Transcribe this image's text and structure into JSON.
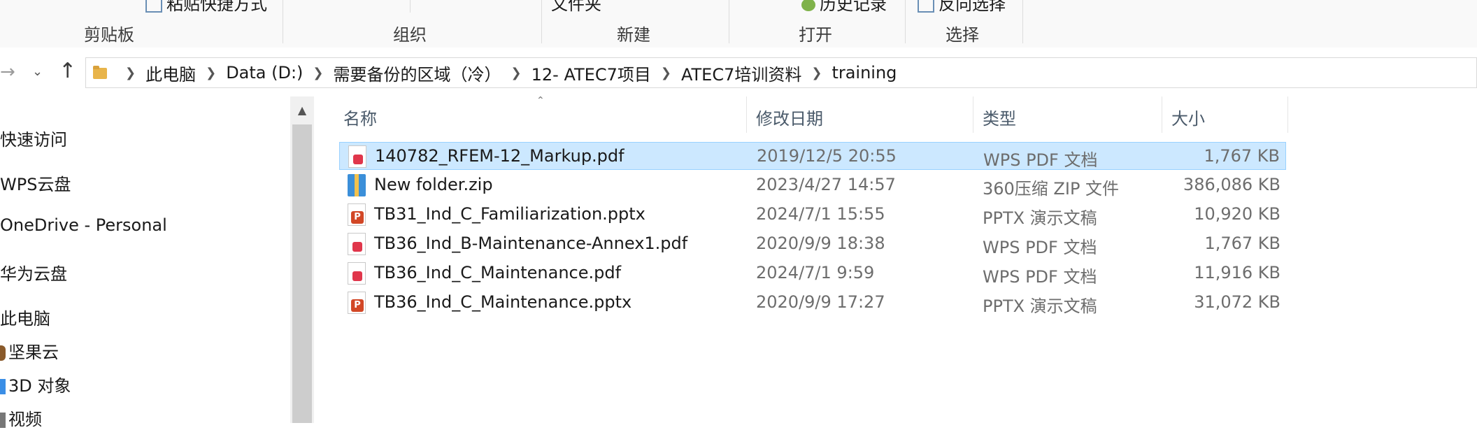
{
  "ribbon": {
    "groups": [
      {
        "label": "剪贴板"
      },
      {
        "label": "组织"
      },
      {
        "label": "新建"
      },
      {
        "label": "打开"
      },
      {
        "label": "选择"
      }
    ],
    "cut_text_1": "粘贴快捷方式",
    "cut_text_2": "文件夹",
    "cut_text_3": "历史记录",
    "cut_text_4": "反向选择"
  },
  "nav": {
    "back_icon": "back-arrow-icon",
    "forward_icon": "forward-arrow-icon",
    "recent_icon": "chevron-down-icon",
    "up_icon": "up-arrow-icon"
  },
  "breadcrumb": [
    "此电脑",
    "Data (D:)",
    "需要备份的区域（冷）",
    "12- ATEC7项目",
    "ATEC7培训资料",
    "training"
  ],
  "sidebar": {
    "items": [
      {
        "label": "快速访问"
      },
      {
        "label": "WPS云盘"
      },
      {
        "label": "OneDrive - Personal"
      },
      {
        "label": "华为云盘"
      },
      {
        "label": "此电脑"
      },
      {
        "label": "坚果云"
      },
      {
        "label": "3D 对象"
      },
      {
        "label": "视频"
      }
    ]
  },
  "columns": {
    "name": "名称",
    "date": "修改日期",
    "type": "类型",
    "size": "大小"
  },
  "files": [
    {
      "name": "140782_RFEM-12_Markup.pdf",
      "date": "2019/12/5 20:55",
      "type": "WPS PDF 文档",
      "size": "1,767 KB",
      "icon": "pdf-icon",
      "selected": true
    },
    {
      "name": "New folder.zip",
      "date": "2023/4/27 14:57",
      "type": "360压缩 ZIP 文件",
      "size": "386,086 KB",
      "icon": "zip-icon",
      "selected": false
    },
    {
      "name": "TB31_Ind_C_Familiarization.pptx",
      "date": "2024/7/1 15:55",
      "type": "PPTX 演示文稿",
      "size": "10,920 KB",
      "icon": "pptx-icon",
      "selected": false
    },
    {
      "name": "TB36_Ind_B-Maintenance-Annex1.pdf",
      "date": "2020/9/9 18:38",
      "type": "WPS PDF 文档",
      "size": "1,767 KB",
      "icon": "pdf-icon",
      "selected": false
    },
    {
      "name": "TB36_Ind_C_Maintenance.pdf",
      "date": "2024/7/1 9:59",
      "type": "WPS PDF 文档",
      "size": "11,916 KB",
      "icon": "pdf-icon",
      "selected": false
    },
    {
      "name": "TB36_Ind_C_Maintenance.pptx",
      "date": "2020/9/9 17:27",
      "type": "PPTX 演示文稿",
      "size": "31,072 KB",
      "icon": "pptx-icon",
      "selected": false
    }
  ],
  "colors": {
    "selection_bg": "#cce8ff",
    "selection_border": "#99d1ff"
  }
}
